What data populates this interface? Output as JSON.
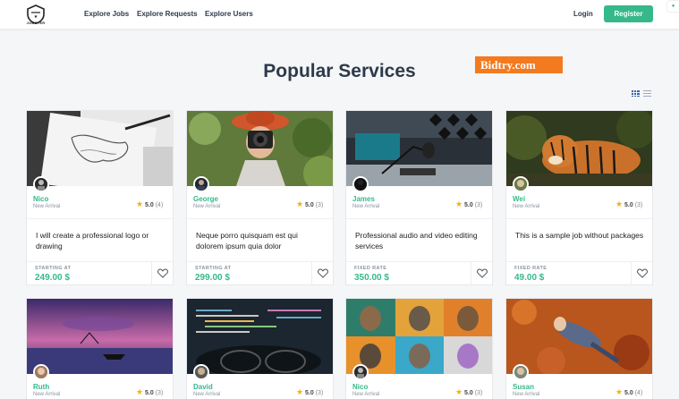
{
  "header": {
    "logo_text": "JOBSTER",
    "nav": [
      "Explore Jobs",
      "Explore Requests",
      "Explore Users"
    ],
    "login": "Login",
    "register": "Register"
  },
  "section": {
    "title": "Popular Services",
    "watermark": "Bidtry.com"
  },
  "cards": [
    {
      "seller": "Nico",
      "sub": "New Arrival",
      "score": "5.0",
      "count": "(4)",
      "title": "I will create a professional logo or drawing",
      "price_label": "STARTING AT",
      "price": "249.00 $"
    },
    {
      "seller": "George",
      "sub": "New Arrival",
      "score": "5.0",
      "count": "(3)",
      "title": "Neque porro quisquam est qui dolorem ipsum quia dolor",
      "price_label": "STARTING AT",
      "price": "299.00 $"
    },
    {
      "seller": "James",
      "sub": "New Arrival",
      "score": "5.0",
      "count": "(3)",
      "title": "Professional audio and video editing services",
      "price_label": "FIXED RATE",
      "price": "350.00 $"
    },
    {
      "seller": "Wei",
      "sub": "New Arrival",
      "score": "5.0",
      "count": "(3)",
      "title": "This is a sample job without packages",
      "price_label": "FIXED RATE",
      "price": "49.00 $"
    },
    {
      "seller": "Ruth",
      "sub": "New Arrival",
      "score": "5.0",
      "count": "(3)"
    },
    {
      "seller": "David",
      "sub": "New Arrival",
      "score": "5.0",
      "count": "(3)"
    },
    {
      "seller": "Nico",
      "sub": "New Arrival",
      "score": "5.0",
      "count": "(3)"
    },
    {
      "seller": "Susan",
      "sub": "New Arrival",
      "score": "5.0",
      "count": "(4)"
    }
  ],
  "icons": {
    "star": "star-icon",
    "favorite": "heart-icon",
    "grid_view": "grid-view-icon",
    "list_view": "list-view-icon"
  },
  "colors": {
    "accent": "#35b98a",
    "star": "#f5b301",
    "title": "#2d3a4a"
  }
}
